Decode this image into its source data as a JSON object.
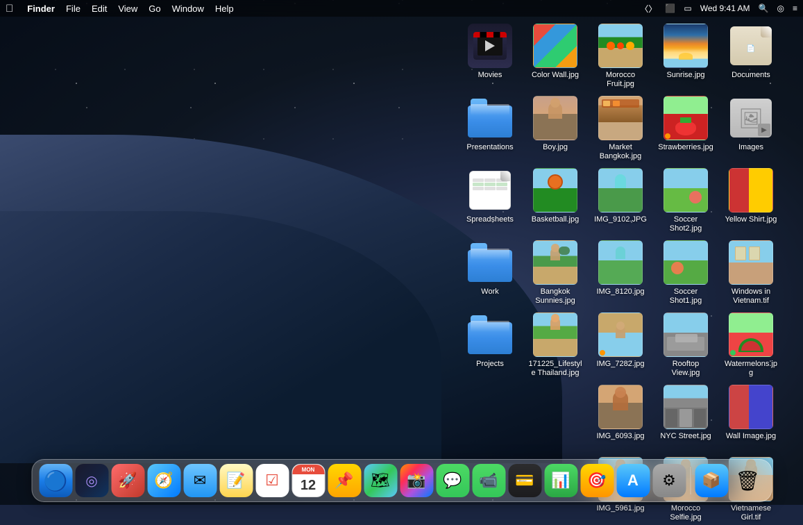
{
  "menubar": {
    "apple": "",
    "appName": "Finder",
    "menus": [
      "File",
      "Edit",
      "View",
      "Go",
      "Window",
      "Help"
    ],
    "time": "Wed 9:41 AM",
    "wifi": "wifi",
    "airplay": "airplay",
    "siri": "siri",
    "controlcenter": "controlcenter"
  },
  "desktop": {
    "icons": [
      {
        "id": "movies",
        "label": "Movies",
        "type": "special-folder",
        "col": 1,
        "row": 1
      },
      {
        "id": "color-wall",
        "label": "Color Wall.jpg",
        "type": "image",
        "style": "photo-colorwall",
        "col": 2,
        "row": 1
      },
      {
        "id": "morocco-fruit",
        "label": "Morocco Fruit.jpg",
        "type": "image",
        "style": "photo-morocco-fruit",
        "col": 3,
        "row": 1
      },
      {
        "id": "sunrise",
        "label": "Sunrise.jpg",
        "type": "image",
        "style": "photo-sunrise",
        "col": 4,
        "row": 1
      },
      {
        "id": "documents",
        "label": "Documents",
        "type": "special-folder",
        "col": 5,
        "row": 1
      },
      {
        "id": "presentations",
        "label": "Presentations",
        "type": "folder",
        "col": 1,
        "row": 2
      },
      {
        "id": "boy",
        "label": "Boy.jpg",
        "type": "image",
        "style": "photo-boy",
        "col": 2,
        "row": 2
      },
      {
        "id": "market-bangkok",
        "label": "Market Bangkok.jpg",
        "type": "image",
        "style": "photo-market",
        "col": 3,
        "row": 2
      },
      {
        "id": "strawberries",
        "label": "Strawberries.jpg",
        "type": "image",
        "style": "photo-strawberries",
        "col": 4,
        "row": 2,
        "dot": "orange"
      },
      {
        "id": "images",
        "label": "Images",
        "type": "images-folder",
        "col": 5,
        "row": 2
      },
      {
        "id": "spreadsheets",
        "label": "Spreadsheets",
        "type": "spreadsheet-folder",
        "col": 1,
        "row": 3
      },
      {
        "id": "basketball",
        "label": "Basketball.jpg",
        "type": "image",
        "style": "photo-basketball",
        "col": 2,
        "row": 3
      },
      {
        "id": "img9102",
        "label": "IMG_9102.JPG",
        "type": "image",
        "style": "photo-img9102",
        "col": 3,
        "row": 3
      },
      {
        "id": "soccer-shot2",
        "label": "Soccer Shot2.jpg",
        "type": "image",
        "style": "photo-soccershot2",
        "col": 4,
        "row": 3
      },
      {
        "id": "yellow-shirt",
        "label": "Yellow Shirt.jpg",
        "type": "image",
        "style": "photo-yellowshirt",
        "col": 5,
        "row": 3
      },
      {
        "id": "work",
        "label": "Work",
        "type": "folder",
        "col": 1,
        "row": 4
      },
      {
        "id": "bangkok-sun",
        "label": "Bangkok Sunnies.jpg",
        "type": "image",
        "style": "photo-bangkok-sun",
        "col": 2,
        "row": 4
      },
      {
        "id": "img8120",
        "label": "IMG_8120.jpg",
        "type": "image",
        "style": "photo-img8120",
        "col": 3,
        "row": 4
      },
      {
        "id": "soccer-shot1",
        "label": "Soccer Shot1.jpg",
        "type": "image",
        "style": "photo-soccershot1",
        "col": 4,
        "row": 4
      },
      {
        "id": "windows-vn",
        "label": "Windows in Vietnam.tif",
        "type": "image",
        "style": "photo-windows-vn",
        "col": 5,
        "row": 4
      },
      {
        "id": "projects",
        "label": "Projects",
        "type": "folder",
        "col": 1,
        "row": 5
      },
      {
        "id": "lifestyle",
        "label": "171225_Lifestyle Thailand.jpg",
        "type": "image",
        "style": "photo-lifestyle",
        "col": 2,
        "row": 5
      },
      {
        "id": "img7282",
        "label": "IMG_7282.jpg",
        "type": "image",
        "style": "photo-img7282",
        "col": 3,
        "row": 5,
        "dot": "orange"
      },
      {
        "id": "rooftop",
        "label": "Rooftop View.jpg",
        "type": "image",
        "style": "photo-rooftop",
        "col": 4,
        "row": 5
      },
      {
        "id": "watermelons",
        "label": "Watermelons.jpg",
        "type": "image",
        "style": "photo-watermelons",
        "col": 5,
        "row": 5,
        "dot": "green"
      },
      {
        "id": "img6093",
        "label": "IMG_6093.jpg",
        "type": "image",
        "style": "photo-img6093",
        "col": 3,
        "row": 6
      },
      {
        "id": "nyc-street",
        "label": "NYC Street.jpg",
        "type": "image",
        "style": "photo-nycstreet",
        "col": 4,
        "row": 6
      },
      {
        "id": "wall-image",
        "label": "Wall Image.jpg",
        "type": "image",
        "style": "photo-wallimage",
        "col": 5,
        "row": 6
      },
      {
        "id": "img5961",
        "label": "IMG_5961.jpg",
        "type": "image",
        "style": "photo-img5961",
        "col": 3,
        "row": 7
      },
      {
        "id": "morocco-selfie",
        "label": "Morocco Selfie.jpg",
        "type": "image",
        "style": "photo-morocco-selfie",
        "col": 4,
        "row": 7
      },
      {
        "id": "vietnamese-girl",
        "label": "Vietnamese Girl.tif",
        "type": "image",
        "style": "photo-vietnamese",
        "col": 5,
        "row": 7
      }
    ]
  },
  "dock": {
    "items": [
      {
        "id": "finder",
        "label": "Finder",
        "emoji": "🔵",
        "style": "dock-finder"
      },
      {
        "id": "siri",
        "label": "Siri",
        "emoji": "◎",
        "style": "dock-siri"
      },
      {
        "id": "launchpad",
        "label": "Launchpad",
        "emoji": "🚀",
        "style": "dock-launchpad"
      },
      {
        "id": "safari",
        "label": "Safari",
        "emoji": "🧭",
        "style": "dock-safari"
      },
      {
        "id": "mail",
        "label": "Mail",
        "emoji": "✉",
        "style": "dock-mail"
      },
      {
        "id": "notes",
        "label": "Notes",
        "emoji": "📝",
        "style": "dock-notes"
      },
      {
        "id": "reminders",
        "label": "Reminders",
        "emoji": "☑",
        "style": "dock-reminders"
      },
      {
        "id": "calendar",
        "label": "Calendar",
        "emoji": "12",
        "style": "dock-calendar"
      },
      {
        "id": "stickies",
        "label": "Stickies",
        "emoji": "📌",
        "style": "dock-stickies"
      },
      {
        "id": "maps",
        "label": "Maps",
        "emoji": "🗺",
        "style": "dock-maps"
      },
      {
        "id": "photos",
        "label": "Photos",
        "emoji": "⬡",
        "style": "dock-photos"
      },
      {
        "id": "messages",
        "label": "Messages",
        "emoji": "💬",
        "style": "dock-messages"
      },
      {
        "id": "facetime",
        "label": "FaceTime",
        "emoji": "📷",
        "style": "dock-facetime"
      },
      {
        "id": "wallet",
        "label": "Wallet",
        "emoji": "💳",
        "style": "dock-wallet"
      },
      {
        "id": "numbers",
        "label": "Numbers",
        "emoji": "📊",
        "style": "dock-numbers"
      },
      {
        "id": "keynote",
        "label": "Keynote",
        "emoji": "🎯",
        "style": "dock-keynote"
      },
      {
        "id": "appstore",
        "label": "App Store",
        "emoji": "A",
        "style": "dock-appstore"
      },
      {
        "id": "sysprefs",
        "label": "System Preferences",
        "emoji": "⚙",
        "style": "dock-sysprefs"
      },
      {
        "id": "archive",
        "label": "Archive",
        "emoji": "📦",
        "style": "dock-archive"
      },
      {
        "id": "trash",
        "label": "Trash",
        "emoji": "🗑",
        "style": "dock-trash"
      }
    ]
  }
}
